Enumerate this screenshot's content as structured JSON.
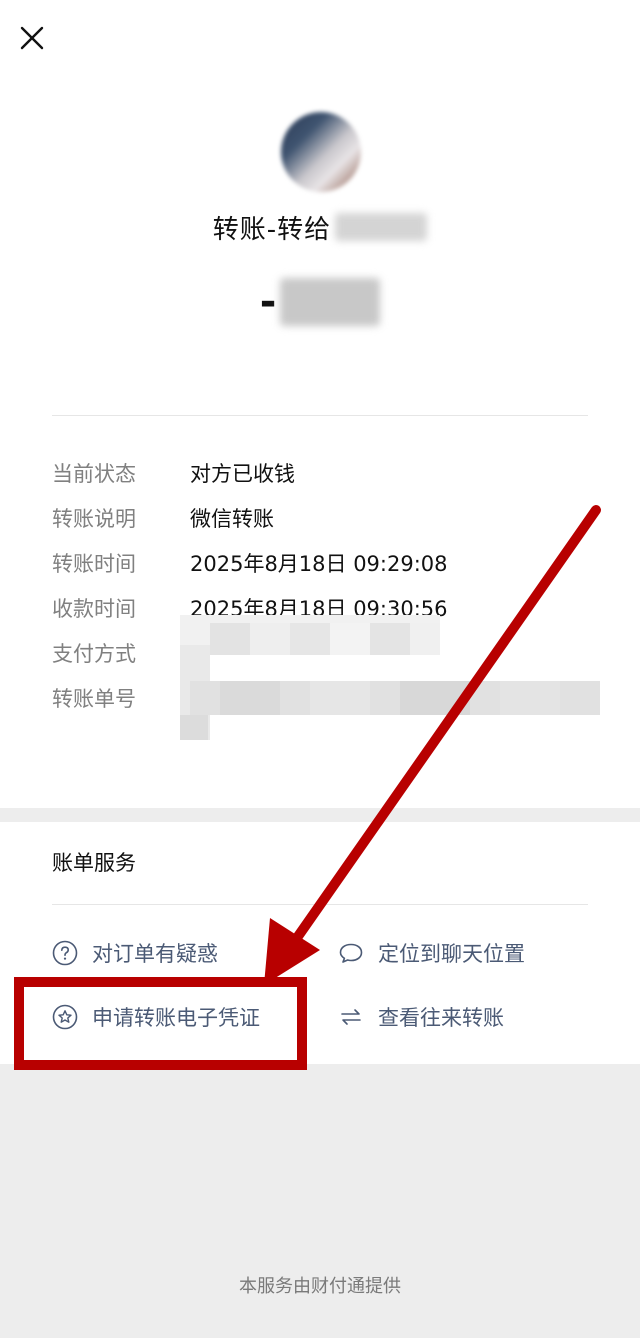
{
  "header": {
    "close_icon": "close-icon"
  },
  "transfer": {
    "title_prefix": "转账-转给",
    "amount_sign": "-"
  },
  "details": [
    {
      "label": "当前状态",
      "value": "对方已收钱"
    },
    {
      "label": "转账说明",
      "value": "微信转账"
    },
    {
      "label": "转账时间",
      "value": "2025年8月18日 09:29:08"
    },
    {
      "label": "收款时间",
      "value": "2025年8月18日 09:30:56"
    },
    {
      "label": "支付方式",
      "value": ""
    },
    {
      "label": "转账单号",
      "value": ""
    }
  ],
  "services": {
    "title": "账单服务",
    "items": [
      {
        "label": "对订单有疑惑",
        "icon": "question-circle-icon"
      },
      {
        "label": "定位到聊天位置",
        "icon": "chat-bubble-icon"
      },
      {
        "label": "申请转账电子凭证",
        "icon": "star-circle-icon"
      },
      {
        "label": "查看往来转账",
        "icon": "swap-arrows-icon"
      }
    ]
  },
  "footer": {
    "text": "本服务由财付通提供"
  },
  "colors": {
    "link": "#4b5a75",
    "annotation": "#b80000",
    "background": "#ededed"
  }
}
